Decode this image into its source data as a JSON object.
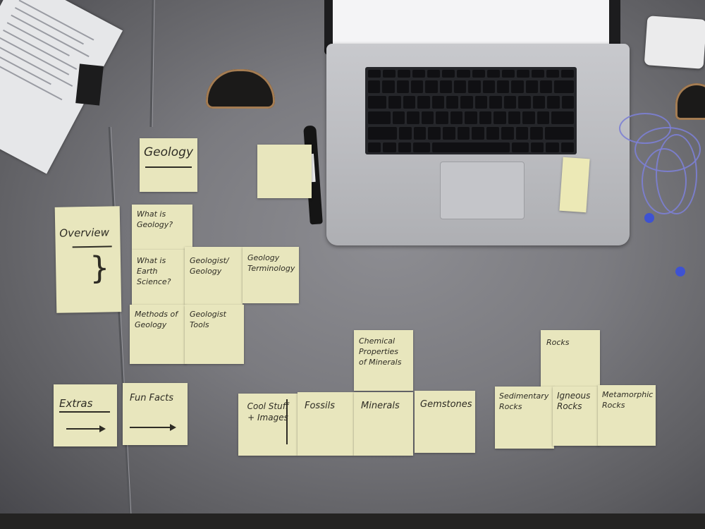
{
  "notes": {
    "geology": "Geology",
    "overview": "Overview",
    "overview_brace": "}",
    "what_is_geology": "What is Geology?",
    "what_is_earth_science": "What is Earth Science?",
    "geologist_geology": "Geologist/ Geology",
    "geology_terminology": "Geology Terminology",
    "methods_of_geology": "Methods of Geology",
    "geologist_tools": "Geologist Tools",
    "extras": "Extras",
    "fun_facts": "Fun Facts",
    "cool_stuff_images": "Cool Stuff + Images",
    "fossils": "Fossils",
    "minerals": "Minerals",
    "chemical_properties": "Chemical Properties of Minerals",
    "gemstones": "Gemstones",
    "rocks": "Rocks",
    "sedimentary_rocks": "Sedimentary Rocks",
    "igneous_rocks": "Igneous Rocks",
    "metamorphic_rocks": "Metamorphic Rocks"
  },
  "colors": {
    "sticky_note": "#e8e6bd",
    "ink": "#2e2c24",
    "table": "#8d8d92",
    "cable": "#7c7fd4"
  },
  "icons": [
    "marker-icon",
    "laptop-icon",
    "earbuds-icon",
    "power-adapter-icon"
  ]
}
